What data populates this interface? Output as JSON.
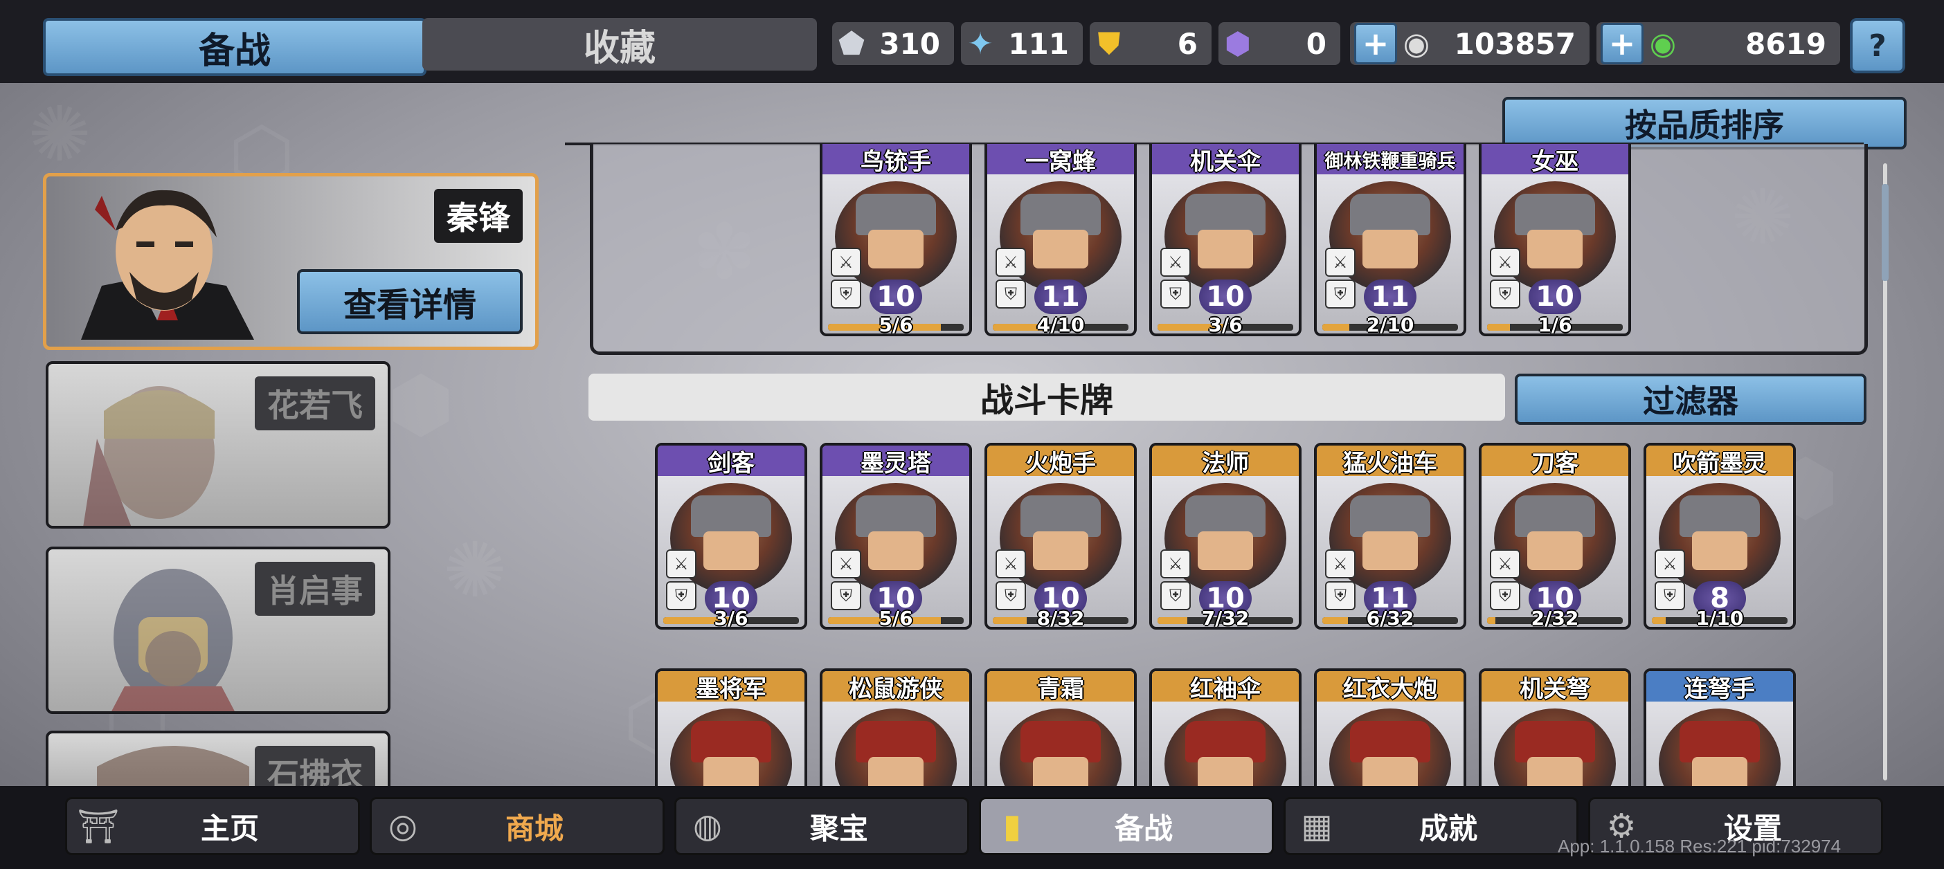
{
  "top_tabs": {
    "active": "备战",
    "inactive": "收藏"
  },
  "resources": [
    {
      "icon": "silver-crystal-icon",
      "value": "310"
    },
    {
      "icon": "blue-crystal-icon",
      "value": "111"
    },
    {
      "icon": "gold-badge-icon",
      "value": "6"
    },
    {
      "icon": "purple-gem-icon",
      "value": "0"
    },
    {
      "icon": "silver-coin-icon",
      "value": "103857",
      "has_plus": true
    },
    {
      "icon": "green-coin-icon",
      "value": "8619",
      "has_plus": true
    }
  ],
  "help_label": "?",
  "heroes": [
    {
      "name": "秦锋",
      "selected": true,
      "detail_label": "查看详情"
    },
    {
      "name": "花若飞",
      "selected": false
    },
    {
      "name": "肖启事",
      "selected": false
    },
    {
      "name": "石拂衣",
      "selected": false
    }
  ],
  "sort_label": "按品质排序",
  "deck_cards": [
    {
      "name": "鸟铳手",
      "level": "10",
      "count": "5/6",
      "progress": 0.83,
      "rarity": "purple"
    },
    {
      "name": "一窝蜂",
      "level": "11",
      "count": "4/10",
      "progress": 0.4,
      "rarity": "purple"
    },
    {
      "name": "机关伞",
      "level": "10",
      "count": "3/6",
      "progress": 0.5,
      "rarity": "purple"
    },
    {
      "name": "御林铁鞭重骑兵",
      "level": "11",
      "count": "2/10",
      "progress": 0.2,
      "rarity": "purple"
    },
    {
      "name": "女巫",
      "level": "10",
      "count": "1/6",
      "progress": 0.17,
      "rarity": "purple"
    }
  ],
  "section_title": "战斗卡牌",
  "filter_label": "过滤器",
  "battle_cards_row1": [
    {
      "name": "剑客",
      "level": "10",
      "count": "3/6",
      "progress": 0.5,
      "rarity": "purple"
    },
    {
      "name": "墨灵塔",
      "level": "10",
      "count": "5/6",
      "progress": 0.83,
      "rarity": "purple"
    },
    {
      "name": "火炮手",
      "level": "10",
      "count": "8/32",
      "progress": 0.25,
      "rarity": "gold"
    },
    {
      "name": "法师",
      "level": "10",
      "count": "7/32",
      "progress": 0.22,
      "rarity": "gold"
    },
    {
      "name": "猛火油车",
      "level": "11",
      "count": "6/32",
      "progress": 0.19,
      "rarity": "gold"
    },
    {
      "name": "刀客",
      "level": "10",
      "count": "2/32",
      "progress": 0.06,
      "rarity": "gold"
    },
    {
      "name": "吹箭墨灵",
      "level": "8",
      "count": "1/10",
      "progress": 0.1,
      "rarity": "gold"
    }
  ],
  "battle_cards_row2": [
    {
      "name": "墨将军",
      "rarity": "gold"
    },
    {
      "name": "松鼠游侠",
      "rarity": "gold"
    },
    {
      "name": "青霜",
      "rarity": "gold"
    },
    {
      "name": "红袖伞",
      "rarity": "gold"
    },
    {
      "name": "红衣大炮",
      "rarity": "gold"
    },
    {
      "name": "机关弩",
      "rarity": "gold"
    },
    {
      "name": "连弩手",
      "rarity": "blue"
    }
  ],
  "bottom_nav": [
    {
      "label": "主页",
      "icon": "home-icon"
    },
    {
      "label": "商城",
      "icon": "coins-icon"
    },
    {
      "label": "聚宝",
      "icon": "treasure-bowl-icon"
    },
    {
      "label": "备战",
      "icon": "cards-icon",
      "active": true
    },
    {
      "label": "成就",
      "icon": "achievement-icon"
    },
    {
      "label": "设置",
      "icon": "gear-icon"
    }
  ],
  "app_info": "App: 1.1.0.158 Res:221 pid:732974",
  "colors": {
    "accent_blue": "#6fa6d6",
    "selected_border": "#e2a04a",
    "shop_orange": "#f0a94e"
  }
}
